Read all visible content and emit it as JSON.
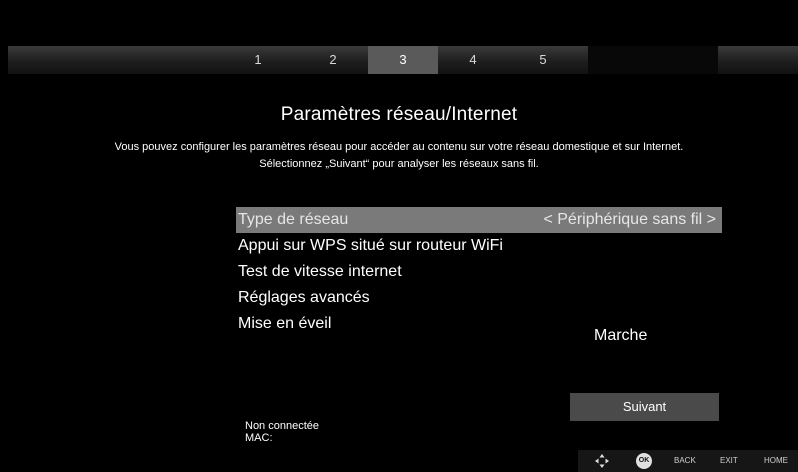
{
  "steps": [
    "1",
    "2",
    "3",
    "4",
    "5"
  ],
  "active_step": "3",
  "title": "Paramètres réseau/Internet",
  "description": {
    "line1": "Vous pouvez configurer les paramètres réseau pour accéder au contenu sur votre réseau domestique et sur Internet.",
    "line2": "Sélectionnez „Suivant“ pour analyser les réseaux sans fil."
  },
  "menu": {
    "items": [
      {
        "label": "Type de réseau",
        "value": "< Périphérique sans fil >",
        "selected": true
      },
      {
        "label": "Appui sur WPS situé sur routeur WiFi"
      },
      {
        "label": "Test de vitesse internet"
      },
      {
        "label": "Réglages avancés"
      },
      {
        "label": "Mise en éveil"
      }
    ],
    "wake_value": "Marche"
  },
  "next_button": "Suivant",
  "status": {
    "connection": "Non connectée",
    "mac": "MAC:"
  },
  "hints": {
    "ok": "OK",
    "back": "BACK",
    "exit": "EXIT",
    "home": "HOME"
  },
  "colors": {
    "selected_row": "#7a7a7a",
    "active_step": "#5a5a5a",
    "button": "#4a4a4a"
  }
}
